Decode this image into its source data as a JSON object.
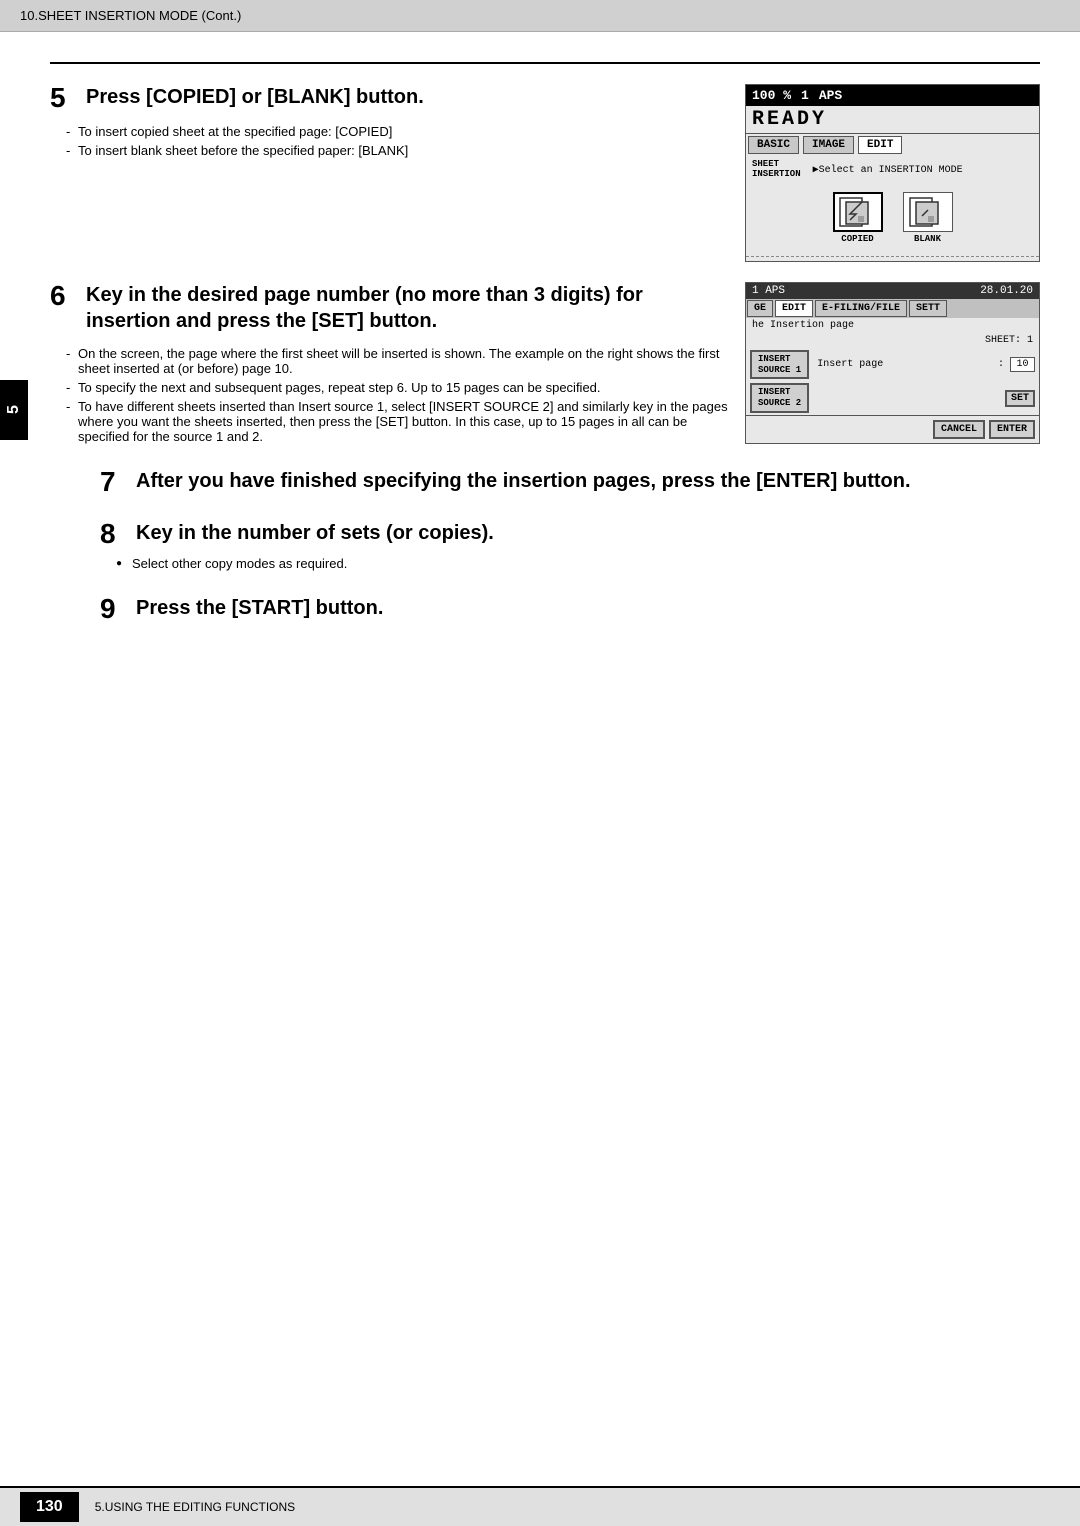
{
  "header": {
    "text": "10.SHEET INSERTION MODE (Cont.)"
  },
  "sidebar_tab": {
    "label": "5"
  },
  "step5": {
    "number": "5",
    "title": "Press [COPIED] or [BLANK] button.",
    "bullets": [
      "To insert copied sheet at the specified page: [COPIED]",
      "To insert blank sheet before the specified paper: [BLANK]"
    ]
  },
  "step6": {
    "number": "6",
    "title": "Key in the desired page number (no more than 3 digits) for insertion and press the [SET] button.",
    "bullets": [
      "On the screen, the page where the first sheet will be inserted is shown. The example on the right shows the first sheet inserted at (or before) page 10.",
      "To specify the next and subsequent pages, repeat step 6. Up to 15 pages can be specified.",
      "To have different sheets inserted than Insert source 1, select [INSERT SOURCE 2] and similarly key in the pages where you want the sheets inserted, then press the [SET] button. In this case, up to 15 pages in all can be specified for the source 1 and 2."
    ]
  },
  "step7": {
    "number": "7",
    "title": "After you have finished specifying the insertion pages, press the [ENTER] button."
  },
  "step8": {
    "number": "8",
    "title": "Key in the number of sets (or copies).",
    "dot_bullets": [
      "Select other copy modes as required."
    ]
  },
  "step9": {
    "number": "9",
    "title": "Press the [START] button."
  },
  "panel1": {
    "header_percent": "100 %",
    "header_num": "1",
    "header_aps": "APS",
    "ready_text": "READY",
    "tab_basic": "BASIC",
    "tab_image": "IMAGE",
    "tab_edit": "EDIT",
    "label_sheet": "SHEET\nINSERTION",
    "label_select": "▶Select an INSERTION MODE",
    "icon1_label": "COPIED",
    "icon2_label": "BLANK"
  },
  "panel2": {
    "header_left": "1  APS",
    "header_right": "28.01.20",
    "tab_ge": "GE",
    "tab_edit": "EDIT",
    "tab_efiling": "E-FILING/FILE",
    "tab_sett": "SETT",
    "insertion_label": "he Insertion page",
    "sheet_label": "SHEET: 1",
    "source1_label": "INSERT\nSOURCE 1",
    "insert_page_label": "Insert page",
    "insert_page_value": "10",
    "source2_label": "INSERT\nSOURCE 2",
    "set_btn": "SET",
    "cancel_btn": "CANCEL",
    "enter_btn": "ENTER"
  },
  "footer": {
    "page": "130",
    "text": "5.USING THE EDITING FUNCTIONS"
  }
}
